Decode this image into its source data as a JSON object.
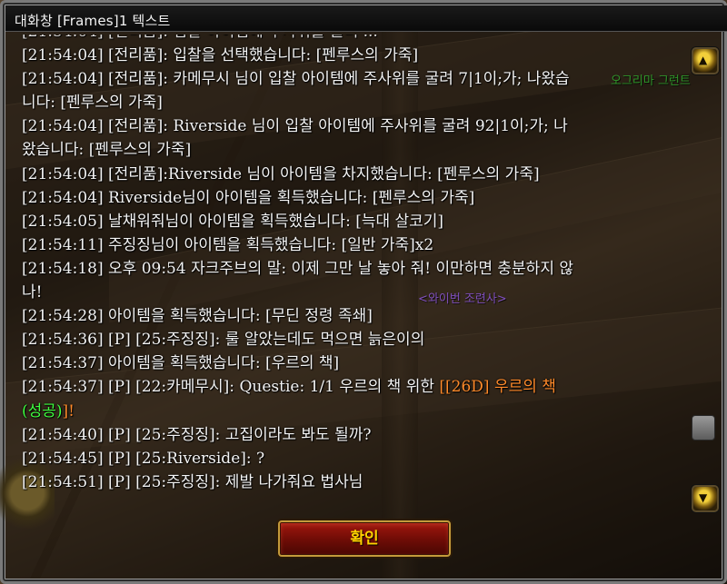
{
  "window": {
    "title": "대화창 [Frames]1 텍스트"
  },
  "chat": {
    "lines": [
      {
        "text": "[21:54:04] [전리품]: 입찰을 선택했습니다: [펜루스의 가죽]"
      },
      {
        "text": "[21:54:04] [전리품]: 카메무시 님이 입찰 아이템에 주사위를 굴려 7|1이;가; 나왔습"
      },
      {
        "text": "니다: [펜루스의 가죽]"
      },
      {
        "text": "[21:54:04] [전리품]: Riverside 님이 입찰 아이템에 주사위를 굴려 92|1이;가; 나"
      },
      {
        "text": "왔습니다: [펜루스의 가죽]"
      },
      {
        "text": "[21:54:04] [전리품]:Riverside 님이 아이템을 차지했습니다: [펜루스의 가죽]"
      },
      {
        "text": "[21:54:04] Riverside님이 아이템을 획득했습니다: [펜루스의 가죽]"
      },
      {
        "text": "[21:54:05] 날채워줘님이 아이템을 획득했습니다: [늑대 살코기]"
      },
      {
        "text": "[21:54:11] 주징징님이 아이템을 획득했습니다: [일반 가죽]x2"
      },
      {
        "text": "[21:54:18] 오후 09:54 자크주브의 말: 이제 그만 날 놓아 줘! 이만하면 충분하지 않"
      },
      {
        "text": "나!"
      },
      {
        "text": "[21:54:28] 아이템을 획득했습니다: [무딘 정령 족쇄]"
      },
      {
        "text": "[21:54:36] [P] [25:주징징]: 룰 알았는데도 먹으면 늙은이의"
      },
      {
        "text": "[21:54:37] 아이템을 획득했습니다: [우르의 책]"
      }
    ],
    "quest_line": {
      "prefix": "[21:54:37] [P] [22:카메무시]:  Questie: 1/1 우르의 책 위한 ",
      "link": "[[26D] 우르의 책",
      "link2": "(성공)",
      "suffix": "]!"
    },
    "lines_after": [
      {
        "text": "[21:54:40] [P] [25:주징징]: 고집이라도 봐도 될까?"
      },
      {
        "text": "[21:54:45] [P] [25:Riverside]: ?"
      },
      {
        "text": "[21:54:51] [P] [25:주징징]: 제발 나가줘요 법사님"
      }
    ]
  },
  "overhead_labels": {
    "npc1": "오그리마 그런트",
    "npc2": "<와이번 조련사>"
  },
  "buttons": {
    "confirm": "확인"
  },
  "icons": {
    "scroll_up": "chevron-up-icon",
    "scroll_down": "chevron-down-icon"
  },
  "colors": {
    "quest_link": "#ff8a2a",
    "success": "#3fff3f",
    "button_text": "#ffd100"
  }
}
